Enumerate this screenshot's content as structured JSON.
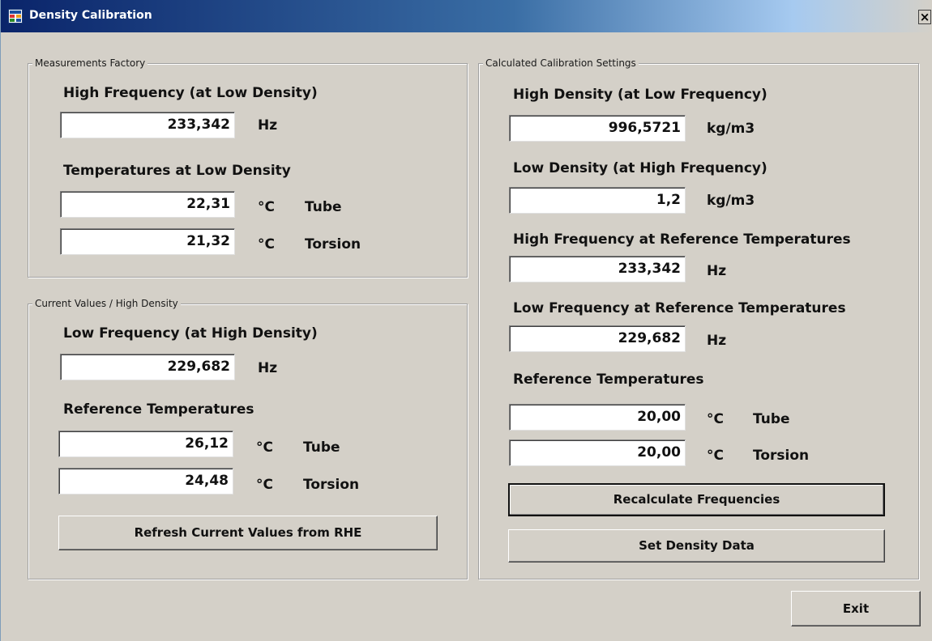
{
  "window": {
    "title": "Density Calibration",
    "close_label": "×"
  },
  "measurements": {
    "legend": "Measurements Factory",
    "high_freq_label": "High Frequency (at Low Density)",
    "high_freq_value": "233,342",
    "high_freq_unit": "Hz",
    "temps_label": "Temperatures at Low Density",
    "tube_value": "22,31",
    "tube_unit": "°C",
    "tube_label": "Tube",
    "torsion_value": "21,32",
    "torsion_unit": "°C",
    "torsion_label": "Torsion"
  },
  "current": {
    "legend": "Current Values / High Density",
    "low_freq_label": "Low Frequency (at High Density)",
    "low_freq_value": "229,682",
    "low_freq_unit": "Hz",
    "ref_temps_label": "Reference Temperatures",
    "tube_value": "26,12",
    "tube_unit": "°C",
    "tube_label": "Tube",
    "torsion_value": "24,48",
    "torsion_unit": "°C",
    "torsion_label": "Torsion",
    "refresh_button": "Refresh Current Values from RHE"
  },
  "calculated": {
    "legend": "Calculated Calibration Settings",
    "high_density_label": "High Density (at Low Frequency)",
    "high_density_value": "996,5721",
    "high_density_unit": "kg/m3",
    "low_density_label": "Low Density (at High Frequency)",
    "low_density_value": "1,2",
    "low_density_unit": "kg/m3",
    "high_freq_ref_label": "High Frequency at Reference Temperatures",
    "high_freq_ref_value": "233,342",
    "high_freq_ref_unit": "Hz",
    "low_freq_ref_label": "Low Frequency at Reference Temperatures",
    "low_freq_ref_value": "229,682",
    "low_freq_ref_unit": "Hz",
    "ref_temps_label": "Reference Temperatures",
    "tube_value": "20,00",
    "tube_unit": "°C",
    "tube_label": "Tube",
    "torsion_value": "20,00",
    "torsion_unit": "°C",
    "torsion_label": "Torsion",
    "recalculate_button": "Recalculate Frequencies",
    "set_density_button": "Set Density Data"
  },
  "footer": {
    "exit_button": "Exit"
  }
}
